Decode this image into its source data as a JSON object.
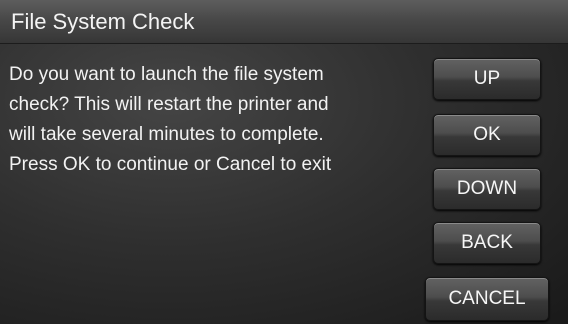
{
  "dialog": {
    "title": "File System Check",
    "message_lines": [
      "Do you want to launch the file system",
      "check? This will restart the printer and",
      "will take several minutes to complete.",
      "Press OK to continue or Cancel to exit"
    ]
  },
  "buttons": {
    "up": "UP",
    "ok": "OK",
    "down": "DOWN",
    "back": "BACK",
    "cancel": "CANCEL"
  }
}
